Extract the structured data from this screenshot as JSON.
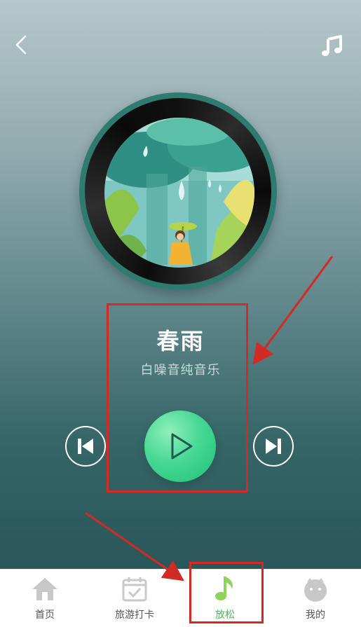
{
  "header": {
    "back_icon": "chevron-left-icon",
    "music_icon": "music-note-icon"
  },
  "player": {
    "title": "春雨",
    "subtitle": "白噪音纯音乐",
    "controls": {
      "prev_icon": "skip-previous-icon",
      "play_icon": "play-icon",
      "next_icon": "skip-next-icon"
    },
    "accent_color": "#47d894"
  },
  "nav": {
    "items": [
      {
        "label": "首页",
        "icon": "home-icon"
      },
      {
        "label": "旅游打卡",
        "icon": "calendar-check-icon"
      },
      {
        "label": "放松",
        "icon": "music-note-icon"
      },
      {
        "label": "我的",
        "icon": "profile-icon"
      }
    ],
    "active_index": 2,
    "active_color": "#49b760"
  },
  "annotations": {
    "highlight_color": "#d22a24"
  }
}
